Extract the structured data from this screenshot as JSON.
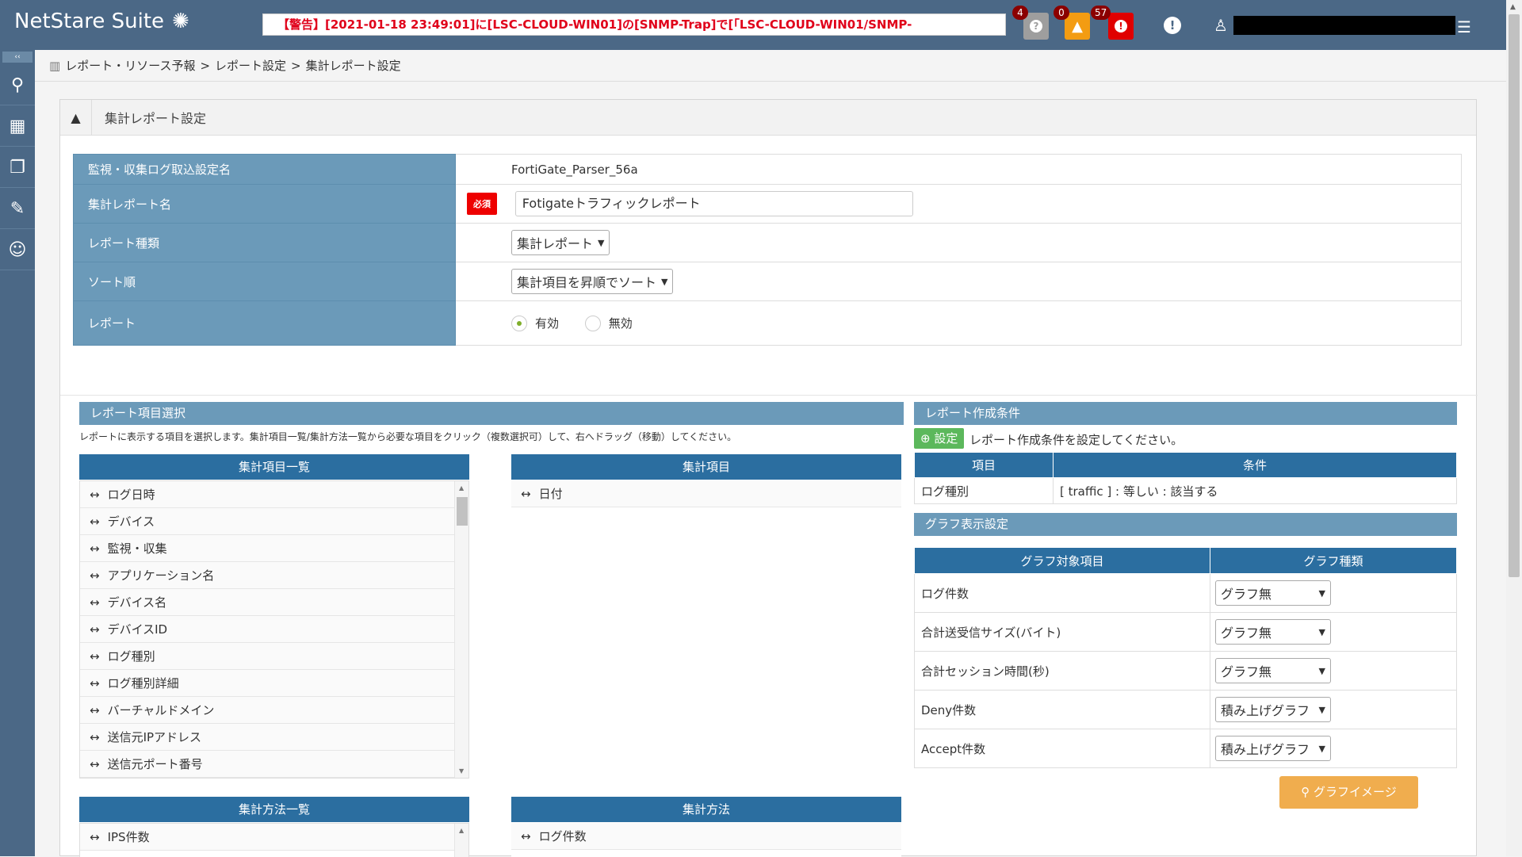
{
  "header": {
    "brand": "NetStare Suite",
    "ticker": "【警告】[2021-01-18 23:49:01]に[LSC-CLOUD-WIN01]の[SNMP-Trap]で[「LSC-CLOUD-WIN01/SNMP-",
    "alerts": [
      {
        "count": "4",
        "color": "#9e9e9e",
        "glyph": "?"
      },
      {
        "count": "0",
        "color": "#f39c12",
        "glyph": "!"
      },
      {
        "count": "57",
        "color": "#e00000",
        "glyph": "!"
      }
    ]
  },
  "breadcrumb": {
    "l1": "レポート・リソース予報",
    "l2": "レポート設定",
    "l3": "集計レポート設定",
    "sep": ">"
  },
  "panel": {
    "title": "集計レポート設定"
  },
  "form": {
    "source_label": "監視・収集ログ取込設定名",
    "source_value": "FortiGate_Parser_56a",
    "name_label": "集計レポート名",
    "required": "必須",
    "name_value": "Fotigateトラフィックレポート",
    "type_label": "レポート種類",
    "type_value": "集計レポート",
    "sort_label": "ソート順",
    "sort_value": "集計項目を昇順でソート",
    "report_label": "レポート",
    "enabled": "有効",
    "disabled": "無効"
  },
  "items_section": {
    "title": "レポート項目選択",
    "desc": "レポートに表示する項目を選択します。集計項目一覧/集計方法一覧から必要な項目をクリック（複数選択可）して、右へドラッグ（移動）してください。",
    "all_items_header": "集計項目一覧",
    "all_items": [
      "ログ日時",
      "デバイス",
      "監視・収集",
      "アプリケーション名",
      "デバイス名",
      "デバイスID",
      "ログ種別",
      "ログ種別詳細",
      "バーチャルドメイン",
      "送信元IPアドレス",
      "送信元ポート番号"
    ],
    "selected_header": "集計項目",
    "selected": [
      "日付"
    ],
    "methods_header": "集計方法一覧",
    "methods": [
      "IPS件数"
    ],
    "selected_methods_header": "集計方法",
    "selected_methods": [
      "ログ件数"
    ]
  },
  "conditions": {
    "title": "レポート作成条件",
    "set_button": "設定",
    "hint": "レポート作成条件を設定してください。",
    "col_item": "項目",
    "col_cond": "条件",
    "rows": [
      {
        "item": "ログ種別",
        "cond": "[ traffic ] : 等しい : 該当する"
      }
    ]
  },
  "graph": {
    "title": "グラフ表示設定",
    "col_target": "グラフ対象項目",
    "col_type": "グラフ種類",
    "rows": [
      {
        "target": "ログ件数",
        "type": "グラフ無"
      },
      {
        "target": "合計送受信サイズ(バイト)",
        "type": "グラフ無"
      },
      {
        "target": "合計セッション時間(秒)",
        "type": "グラフ無"
      },
      {
        "target": "Deny件数",
        "type": "積み上げグラフ"
      },
      {
        "target": "Accept件数",
        "type": "積み上げグラフ"
      }
    ],
    "image_button": "グラフイメージ"
  }
}
